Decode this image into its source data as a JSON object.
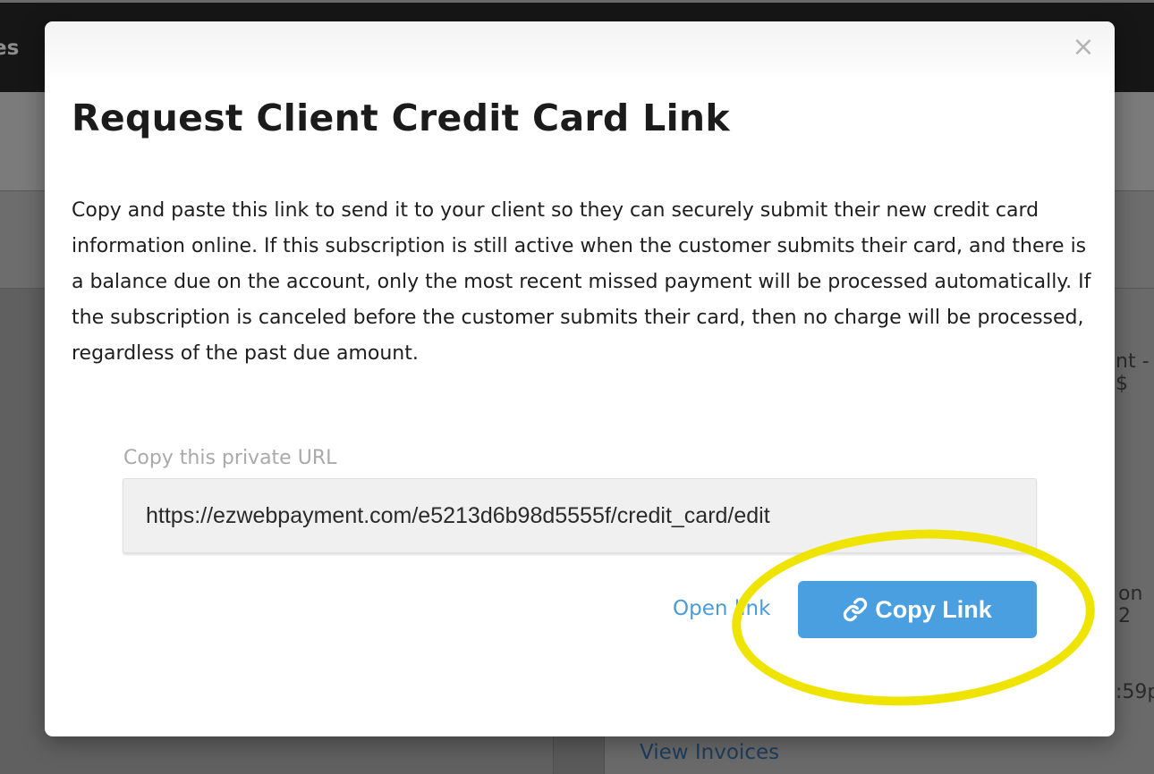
{
  "background": {
    "topbar_fragment": "es",
    "right_fragments": [
      "nt - $",
      "on 2",
      ":59p"
    ],
    "view_invoices_link": "View Invoices"
  },
  "modal": {
    "close_glyph": "×",
    "title": "Request Client Credit Card Link",
    "description": "Copy and paste this link to send it to your client so they can securely submit their new credit card information online. If this subscription is still active when the customer submits their card, and there is a balance due on the account, only the most recent missed payment will be processed automatically. If the subscription is canceled before the customer submits their card, then no charge will be processed, regardless of the past due amount.",
    "url_label": "Copy this private URL",
    "url_value": "https://ezwebpayment.com/e5213d6b98d5555f/credit_card/edit",
    "open_link_label": "Open link",
    "copy_button_label": "Copy Link"
  },
  "icons": {
    "close": "close-icon",
    "copy": "link-icon"
  },
  "colors": {
    "accent_blue": "#4a9fe0",
    "link_blue": "#4b9bd8",
    "highlight_yellow": "#eee400"
  }
}
